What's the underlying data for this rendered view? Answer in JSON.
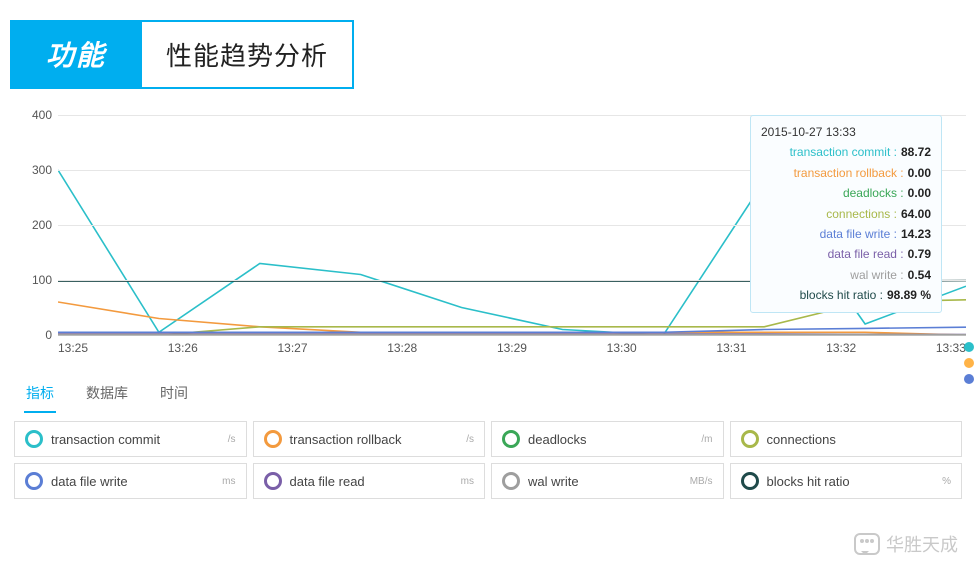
{
  "header": {
    "button": "功能",
    "title": "性能趋势分析"
  },
  "chart_data": {
    "type": "line",
    "title": "",
    "xlabel": "",
    "ylabel": "",
    "ylim": [
      0,
      400
    ],
    "y_ticks": [
      0,
      100,
      200,
      300,
      400
    ],
    "categories": [
      "13:25",
      "13:26",
      "13:27",
      "13:28",
      "13:29",
      "13:30",
      "13:31",
      "13:32",
      "13:33"
    ],
    "series": [
      {
        "name": "transaction commit",
        "color": "#2bbfc9",
        "values": [
          300,
          5,
          130,
          110,
          50,
          10,
          0,
          280,
          20,
          88.72
        ]
      },
      {
        "name": "transaction rollback",
        "color": "#f39a3e",
        "values": [
          60,
          30,
          15,
          5,
          5,
          5,
          5,
          5,
          5,
          0
        ]
      },
      {
        "name": "deadlocks",
        "color": "#3aa757",
        "values": [
          0,
          0,
          0,
          0,
          0,
          0,
          0,
          0,
          0,
          0
        ]
      },
      {
        "name": "connections",
        "color": "#a8b84a",
        "values": [
          0,
          0,
          15,
          15,
          15,
          15,
          15,
          15,
          60,
          64
        ]
      },
      {
        "name": "data file write",
        "color": "#5b7ed5",
        "values": [
          5,
          5,
          5,
          5,
          5,
          5,
          5,
          10,
          12,
          14.23
        ]
      },
      {
        "name": "data file read",
        "color": "#7a5fa8",
        "values": [
          2,
          2,
          2,
          2,
          2,
          2,
          2,
          2,
          1,
          0.79
        ]
      },
      {
        "name": "wal write",
        "color": "#9e9e9e",
        "values": [
          1,
          1,
          1,
          1,
          1,
          1,
          1,
          1,
          1,
          0.54
        ]
      },
      {
        "name": "blocks hit ratio",
        "color": "#1f4a4a",
        "values": [
          98,
          98,
          98,
          98,
          98,
          98,
          98,
          98,
          98,
          98.89
        ]
      }
    ]
  },
  "tooltip": {
    "time": "2015-10-27 13:33",
    "rows": [
      {
        "label": "transaction commit",
        "color": "#2bbfc9",
        "value": "88.72"
      },
      {
        "label": "transaction rollback",
        "color": "#f39a3e",
        "value": "0.00"
      },
      {
        "label": "deadlocks",
        "color": "#3aa757",
        "value": "0.00"
      },
      {
        "label": "connections",
        "color": "#a8b84a",
        "value": "64.00"
      },
      {
        "label": "data file write",
        "color": "#5b7ed5",
        "value": "14.23"
      },
      {
        "label": "data file read",
        "color": "#7a5fa8",
        "value": "0.79"
      },
      {
        "label": "wal write",
        "color": "#9e9e9e",
        "value": "0.54"
      },
      {
        "label": "blocks hit ratio",
        "color": "#1f4a4a",
        "value": "98.89 %"
      }
    ]
  },
  "tabs": [
    {
      "label": "指标",
      "active": true
    },
    {
      "label": "数据库",
      "active": false
    },
    {
      "label": "时间",
      "active": false
    }
  ],
  "legend": [
    {
      "label": "transaction commit",
      "color": "#2bbfc9",
      "unit": "/s"
    },
    {
      "label": "transaction rollback",
      "color": "#f39a3e",
      "unit": "/s"
    },
    {
      "label": "deadlocks",
      "color": "#3aa757",
      "unit": "/m"
    },
    {
      "label": "connections",
      "color": "#a8b84a",
      "unit": ""
    },
    {
      "label": "data file write",
      "color": "#5b7ed5",
      "unit": "ms"
    },
    {
      "label": "data file read",
      "color": "#7a5fa8",
      "unit": "ms"
    },
    {
      "label": "wal write",
      "color": "#9e9e9e",
      "unit": "MB/s"
    },
    {
      "label": "blocks hit ratio",
      "color": "#1f4a4a",
      "unit": "%"
    }
  ],
  "watermark": "华胜天成"
}
